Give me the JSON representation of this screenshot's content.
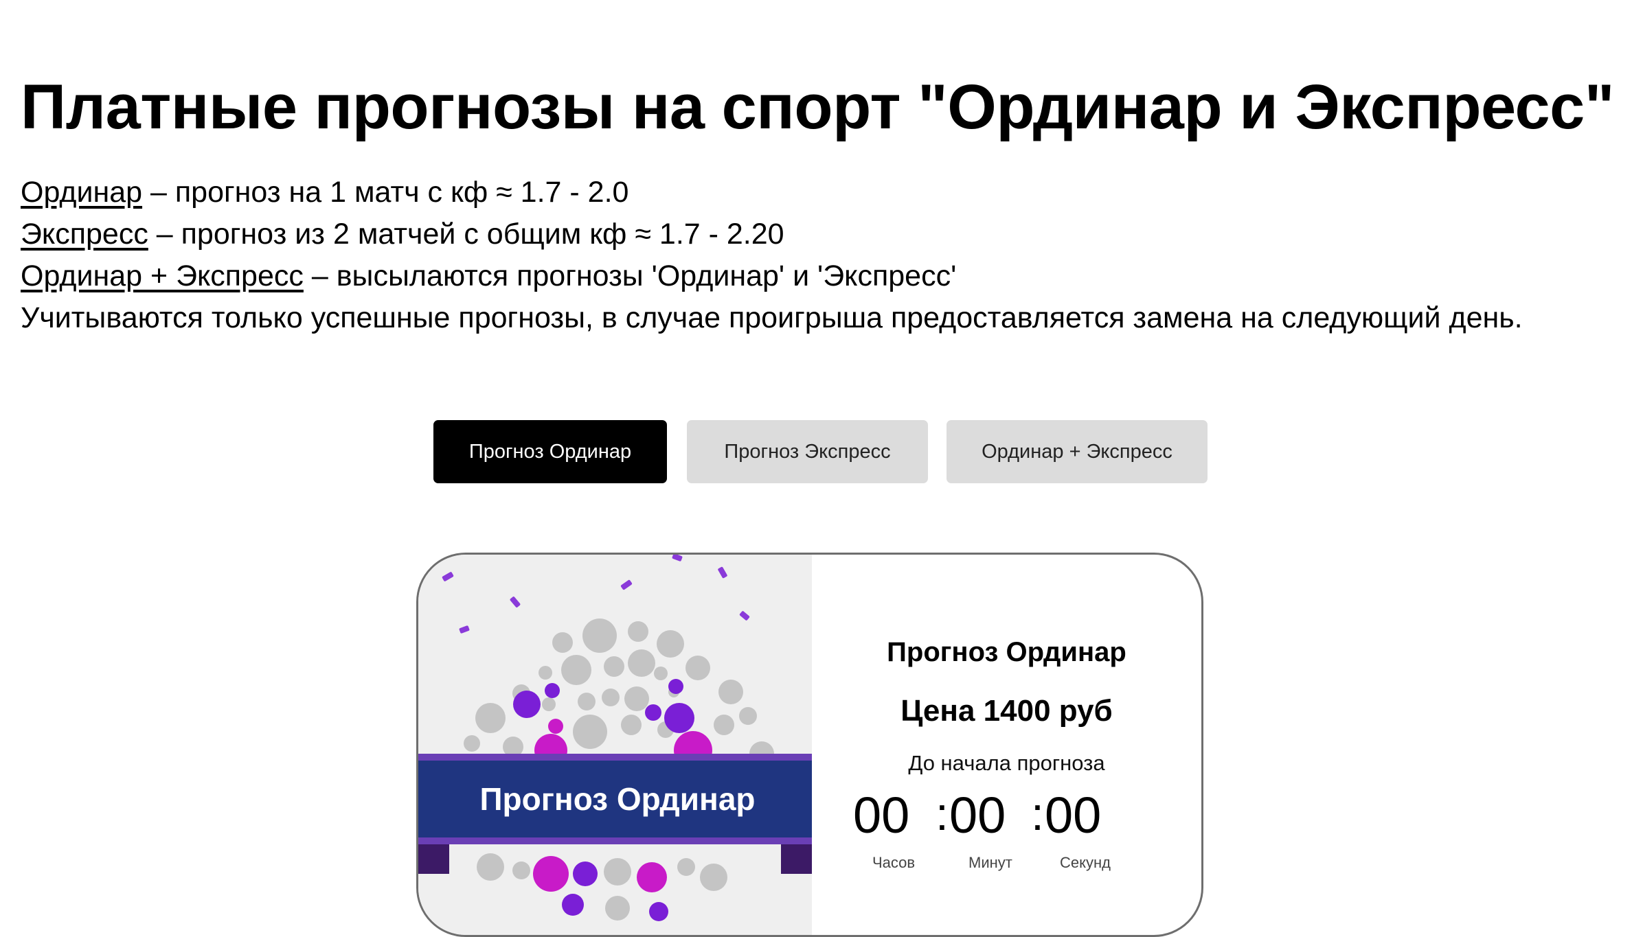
{
  "page": {
    "title": "Платные прогнозы на спорт \"Ординар и Экспресс\""
  },
  "description": {
    "lines": [
      {
        "link": "Ординар",
        "text": " – прогноз на 1 матч с кф ≈ 1.7 - 2.0"
      },
      {
        "link": "Экспресс",
        "text": " – прогноз из 2 матчей с общим кф ≈ 1.7 - 2.20"
      },
      {
        "link": "Ординар + Экспресс",
        "text": " – высылаются прогнозы 'Ординар' и 'Экспресс'"
      }
    ],
    "note": "Учитываются только успешные прогнозы, в случае проигрыша предоставляется замена на следующий день."
  },
  "tabs": [
    {
      "label": "Прогноз Ординар",
      "active": true
    },
    {
      "label": "Прогноз Экспресс",
      "active": false
    },
    {
      "label": "Ординар + Экспресс",
      "active": false
    }
  ],
  "card": {
    "banner_text": "Прогноз Ординар",
    "title": "Прогноз Ординар",
    "price": "Цена 1400 руб",
    "countdown_label": "До начала прогноза",
    "countdown": {
      "hours": "00",
      "minutes": "00",
      "seconds": "00",
      "separator": ":",
      "hours_label": "Часов",
      "minutes_label": "Минут",
      "seconds_label": "Секунд"
    }
  },
  "colors": {
    "banner": "#1f3580",
    "banner_stripe": "#6a3fb5",
    "accent_purple": "#7a1fd6",
    "accent_magenta": "#c81bc8",
    "dot_grey": "#c3c3c3",
    "active_tab": "#000000",
    "inactive_tab": "#dcdcdc"
  }
}
